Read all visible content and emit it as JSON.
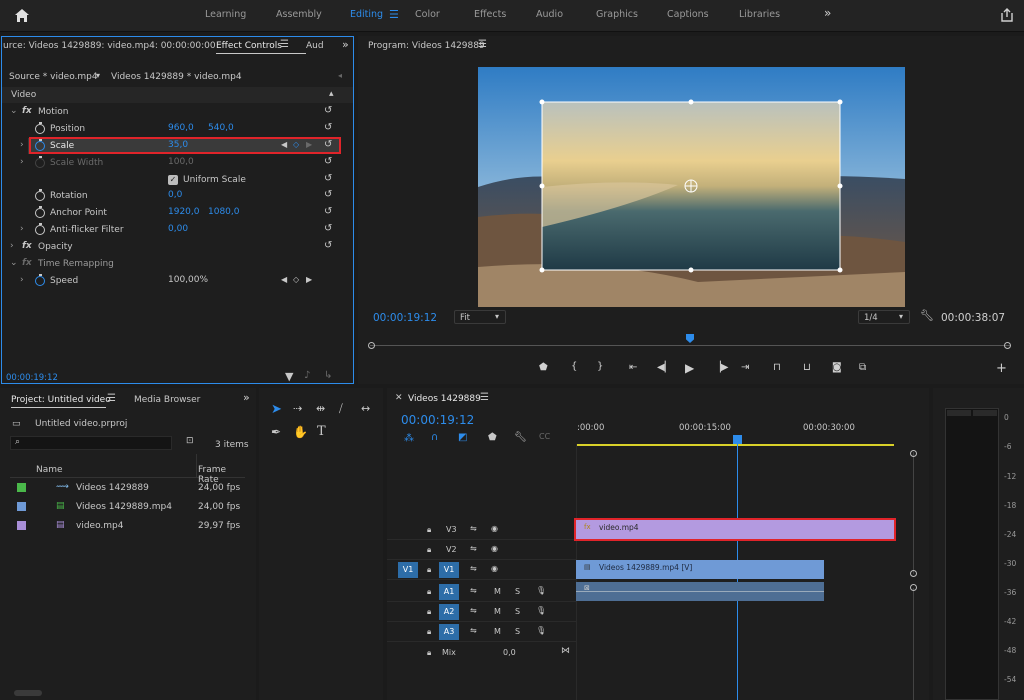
{
  "nav": {
    "items": [
      "Learning",
      "Assembly",
      "Editing",
      "Color",
      "Effects",
      "Audio",
      "Graphics",
      "Captions",
      "Libraries"
    ],
    "active": "Editing",
    "more": "»"
  },
  "effect_controls": {
    "source_tab": "urce: Videos 1429889: video.mp4: 00:00:00:00",
    "active_tab": "Effect Controls",
    "audio_tab": "Aud",
    "source_label": "Source * video.mp4",
    "sequence_label": "Videos 1429889 * video.mp4",
    "section": "Video",
    "motion": "Motion",
    "position_label": "Position",
    "position_x": "960,0",
    "position_y": "540,0",
    "scale_label": "Scale",
    "scale_value": "35,0",
    "scale_width_label": "Scale Width",
    "scale_width_value": "100,0",
    "uniform_scale": "Uniform Scale",
    "rotation_label": "Rotation",
    "rotation_value": "0,0",
    "anchor_label": "Anchor Point",
    "anchor_x": "1920,0",
    "anchor_y": "1080,0",
    "antiflicker_label": "Anti-flicker Filter",
    "antiflicker_value": "0,00",
    "opacity": "Opacity",
    "time_remap": "Time Remapping",
    "speed_label": "Speed",
    "speed_value": "100,00%",
    "timecode": "00:00:19:12"
  },
  "program": {
    "title": "Program: Videos 1429889",
    "timecode": "00:00:19:12",
    "fit": "Fit",
    "resolution": "1/4",
    "duration": "00:00:38:07",
    "playhead_fraction": 0.5
  },
  "project": {
    "tab": "Project: Untitled video",
    "media_browser": "Media Browser",
    "file": "Untitled video.prproj",
    "count": "3 items",
    "col_name": "Name",
    "col_rate": "Frame Rate",
    "items": [
      {
        "name": "Videos 1429889",
        "rate": "24,00 fps",
        "color": "#4ab84a"
      },
      {
        "name": "Videos 1429889.mp4",
        "rate": "24,00 fps",
        "color": "#6f9ad6"
      },
      {
        "name": "video.mp4",
        "rate": "29,97 fps",
        "color": "#a98fd8"
      }
    ]
  },
  "timeline": {
    "tab": "Videos 1429889",
    "timecode": "00:00:19:12",
    "ruler": [
      ":00:00",
      "00:00:15:00",
      "00:00:30:00"
    ],
    "tracks_v": [
      "V3",
      "V2",
      "V1"
    ],
    "tracks_a": [
      "A1",
      "A2",
      "A3"
    ],
    "source_v": "V1",
    "mute": "M",
    "solo": "S",
    "mix": "Mix",
    "mix_value": "0,0",
    "clip_v3": "video.mp4",
    "clip_v1": "Videos 1429889.mp4 [V]"
  },
  "meter": {
    "labels": [
      "0",
      "-6",
      "-12",
      "-18",
      "-24",
      "-30",
      "-36",
      "-42",
      "-48",
      "-54"
    ]
  },
  "colors": {
    "accent": "#2d8ceb",
    "highlight": "#e0242a",
    "clip_purple": "#a98fd8",
    "clip_blue": "#6f9ad6"
  }
}
